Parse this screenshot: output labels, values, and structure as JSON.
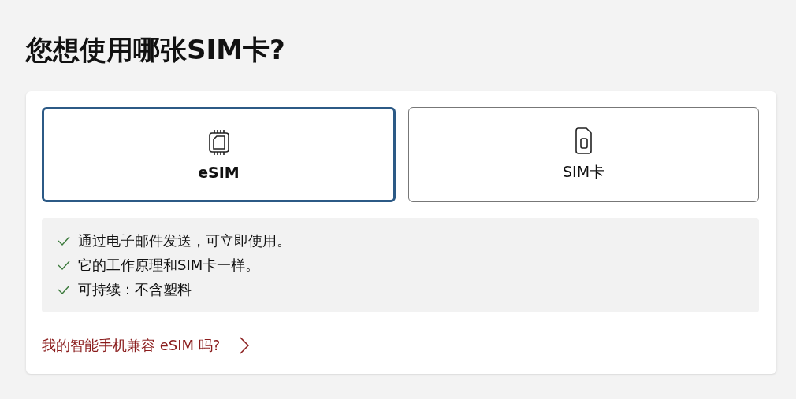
{
  "title": "您想使用哪张SIM卡?",
  "options": [
    {
      "kind": "esim",
      "label": "eSIM",
      "selected": true
    },
    {
      "kind": "sim",
      "label": "SIM卡",
      "selected": false
    }
  ],
  "benefits": [
    "通过电子邮件发送，可立即使用。",
    "它的工作原理和SIM卡一样。",
    "可持续：不含塑料"
  ],
  "link": {
    "label": "我的智能手机兼容 eSIM 吗?"
  }
}
